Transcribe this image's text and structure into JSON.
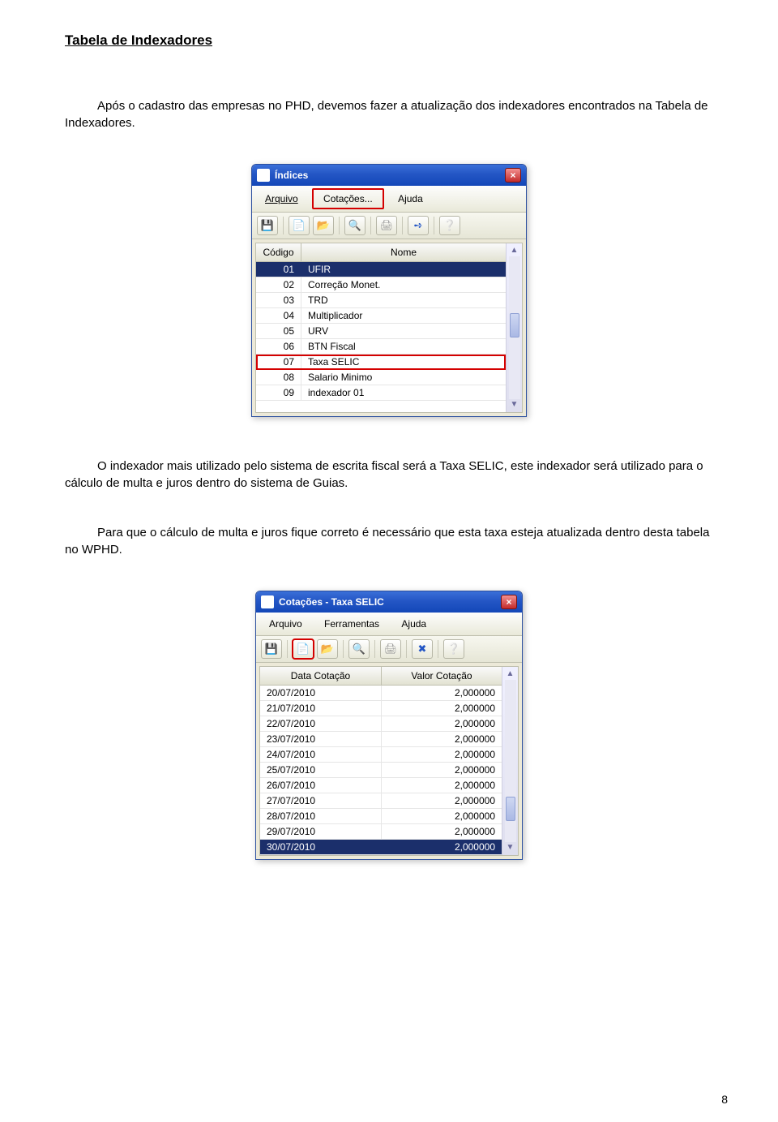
{
  "heading": "Tabela de Indexadores",
  "para1": "Após o cadastro das empresas no PHD, devemos fazer a atualização dos indexadores encontrados na Tabela de Indexadores.",
  "para2": "O indexador mais utilizado pelo sistema de escrita fiscal será a Taxa SELIC, este indexador será utilizado para o cálculo de multa e juros dentro do sistema de Guias.",
  "para3": "Para que  o cálculo de multa e juros fique correto é necessário que esta taxa esteja atualizada dentro desta tabela no WPHD.",
  "page_number": "8",
  "win1": {
    "title": "Índices",
    "menu": {
      "arquivo": "Arquivo",
      "cotacoes": "Cotações...",
      "ajuda": "Ajuda"
    },
    "headers": {
      "codigo": "Código",
      "nome": "Nome"
    },
    "rows": [
      {
        "codigo": "01",
        "nome": "UFIR",
        "selected": true
      },
      {
        "codigo": "02",
        "nome": "Correção Monet."
      },
      {
        "codigo": "03",
        "nome": "TRD"
      },
      {
        "codigo": "04",
        "nome": "Multiplicador"
      },
      {
        "codigo": "05",
        "nome": "URV"
      },
      {
        "codigo": "06",
        "nome": "BTN Fiscal"
      },
      {
        "codigo": "07",
        "nome": "Taxa SELIC",
        "highlight": true
      },
      {
        "codigo": "08",
        "nome": "Salario Minimo"
      },
      {
        "codigo": "09",
        "nome": "indexador 01"
      }
    ]
  },
  "win2": {
    "title": "Cotações - Taxa SELIC",
    "menu": {
      "arquivo": "Arquivo",
      "ferramentas": "Ferramentas",
      "ajuda": "Ajuda"
    },
    "headers": {
      "data": "Data Cotação",
      "valor": "Valor Cotação"
    },
    "rows": [
      {
        "data": "20/07/2010",
        "valor": "2,000000"
      },
      {
        "data": "21/07/2010",
        "valor": "2,000000"
      },
      {
        "data": "22/07/2010",
        "valor": "2,000000"
      },
      {
        "data": "23/07/2010",
        "valor": "2,000000"
      },
      {
        "data": "24/07/2010",
        "valor": "2,000000"
      },
      {
        "data": "25/07/2010",
        "valor": "2,000000"
      },
      {
        "data": "26/07/2010",
        "valor": "2,000000"
      },
      {
        "data": "27/07/2010",
        "valor": "2,000000"
      },
      {
        "data": "28/07/2010",
        "valor": "2,000000"
      },
      {
        "data": "29/07/2010",
        "valor": "2,000000"
      },
      {
        "data": "30/07/2010",
        "valor": "2,000000",
        "selected": true
      }
    ]
  }
}
